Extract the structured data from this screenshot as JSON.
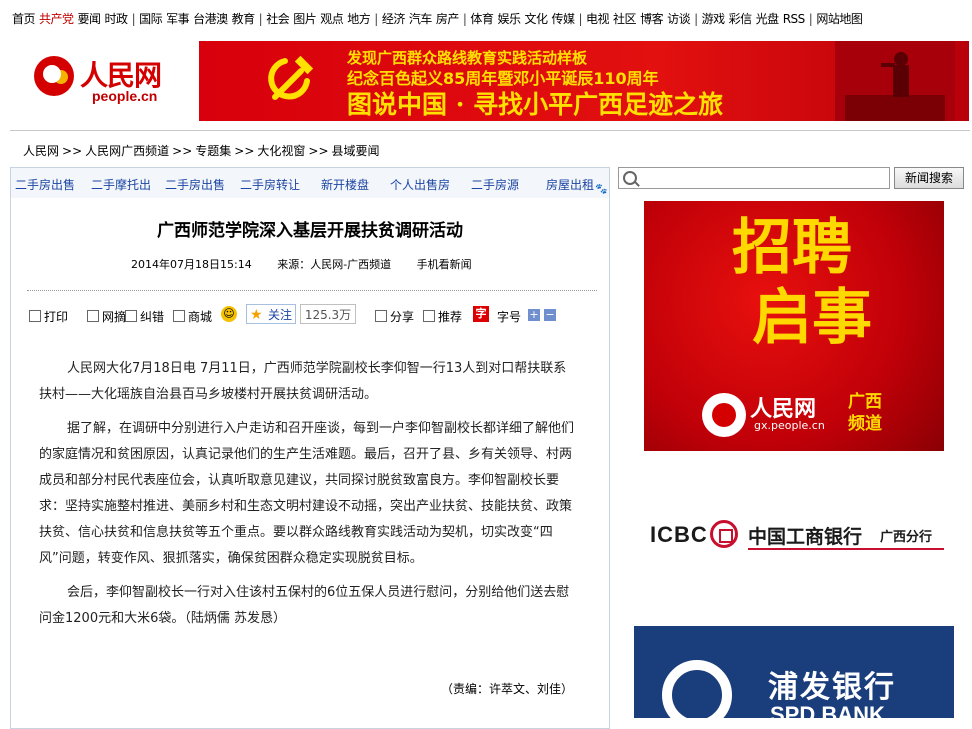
{
  "topnav": {
    "items": [
      "首页",
      "共产党",
      "要闻",
      "时政",
      "|",
      "国际",
      "军事",
      "台港澳",
      "教育",
      "|",
      "社会",
      "图片",
      "观点",
      "地方",
      "|",
      "经济",
      "汽车",
      "房产",
      "|",
      "体育",
      "娱乐",
      "文化",
      "传媒",
      "|",
      "电视",
      "社区",
      "博客",
      "访谈",
      "|",
      "游戏",
      "彩信",
      "光盘",
      "RSS",
      "|",
      "网站地图"
    ]
  },
  "logo": {
    "cn": "人民网",
    "en": "people.cn"
  },
  "banner": {
    "line1": "发现广西群众路线教育实践活动样板",
    "line2": "纪念百色起义85周年暨邓小平诞辰110周年",
    "line3": "图说中国 · 寻找小平广西足迹之旅"
  },
  "breadcrumb": [
    "人民网",
    "人民网广西频道",
    "专题集",
    "大化视窗",
    "县域要闻"
  ],
  "ad_bar": [
    "二手房出售",
    "二手摩托出",
    "二手房出售",
    "二手房转让",
    "新开楼盘",
    "个人出售房",
    "二手房源",
    "房屋出租"
  ],
  "article": {
    "title": "广西师范学院深入基层开展扶贫调研活动",
    "datetime": "2014年07月18日15:14",
    "source": "来源：人民网-广西频道",
    "mobile": "手机看新闻",
    "paragraphs": [
      "人民网大化7月18日电  7月11日，广西师范学院副校长李仰智一行13人到对口帮扶联系扶村——大化瑶族自治县百马乡坡楼村开展扶贫调研活动。",
      "据了解，在调研中分别进行入户走访和召开座谈，每到一户李仰智副校长都详细了解他们的家庭情况和贫困原因，认真记录他们的生产生活难题。最后，召开了县、乡有关领导、村两成员和部分村民代表座位会，认真听取意见建议，共同探讨脱贫致富良方。李仰智副校长要求：坚持实施整村推进、美丽乡村和生态文明村建设不动摇，突出产业扶贫、技能扶贫、政策扶贫、信心扶贫和信息扶贫等五个重点。要以群众路线教育实践活动为契机，切实改变“四风”问题，转变作风、狠抓落实，确保贫困群众稳定实现脱贫目标。",
      "会后，李仰智副校长一行对入住该村五保村的6位五保人员进行慰问，分别给他们送去慰问金1200元和大米6袋。（陆炳儒 苏发恳）"
    ],
    "editor": "（责编：许萃文、刘佳）"
  },
  "tools": {
    "print": "打印",
    "excerpt": "网摘",
    "correct": "纠错",
    "mall": "商城",
    "follow": "关注",
    "follow_count": "125.3万",
    "share": "分享",
    "recommend": "推荐",
    "font_icon": "字",
    "font": "字号",
    "plus": "+",
    "minus": "−"
  },
  "search": {
    "placeholder": "",
    "button": "新闻搜索"
  },
  "ads": {
    "recruit_line1": "招聘",
    "recruit_line2": "启事",
    "recruit_logo_cn": "人民网",
    "recruit_logo_en": "gx.people.cn",
    "recruit_channel": "广西频道",
    "icbc_en": "ICBC",
    "icbc_cn": "中国工商银行",
    "icbc_branch": "广西分行",
    "spdb_cn": "浦发银行",
    "spdb_en": "SPD BANK"
  },
  "colors": {
    "brand_red": "#d40000",
    "link_blue": "#1c46a3",
    "banner_yellow": "#ffe000"
  }
}
